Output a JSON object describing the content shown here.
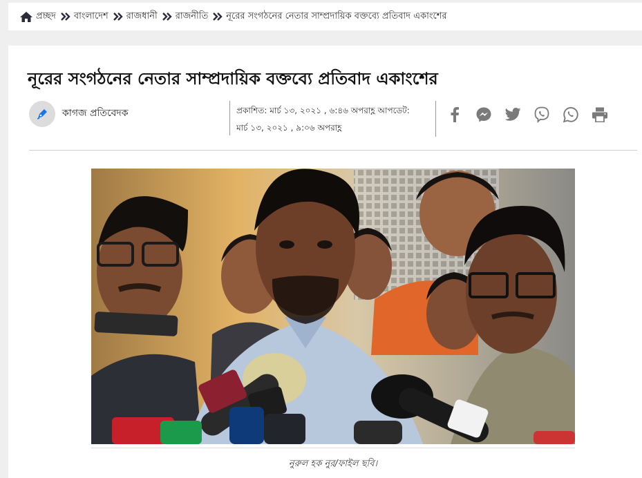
{
  "breadcrumb": {
    "items": [
      "প্রচ্ছদ",
      "বাংলাদেশ",
      "রাজধানী",
      "রাজনীতি",
      "নূরের সংগঠনের নেতার সাম্প্রদায়িক বক্তব্যে প্রতিবাদ একাংশের"
    ]
  },
  "article": {
    "title": "নূরের সংগঠনের নেতার সাম্প্রদায়িক বক্তব্যে প্রতিবাদ একাংশের",
    "author": "কাগজ প্রতিবেদক",
    "published_line": "প্রকাশিত: মার্চ ১৩, ২০২১ , ৬:৪৬ অপরাহ্ণ আপডেট:",
    "updated_line": "মার্চ ১৩, ২০২১ , ৯:০৬ অপরাহ্ণ",
    "caption": "নুরুল হক নুর/ফাইল ছবি।"
  },
  "share_icons": [
    "facebook-icon",
    "messenger-icon",
    "twitter-icon",
    "viber-icon",
    "whatsapp-icon",
    "print-icon"
  ],
  "colors": {
    "icon_gray": "#7a7a7a",
    "navy": "#2b2b3a",
    "avatar_pen": "#1a73e8"
  }
}
